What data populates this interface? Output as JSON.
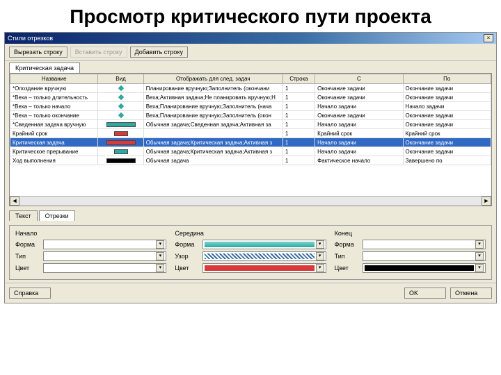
{
  "slide": {
    "title": "Просмотр критического пути проекта"
  },
  "dialog": {
    "title": "Стили отрезков",
    "close": "×",
    "toolbar": {
      "cut": "Вырезать строку",
      "paste": "Вставить строку",
      "add": "Добавить строку"
    },
    "top_tab": "Критическая задача",
    "columns": {
      "name": "Название",
      "vid": "Вид",
      "show": "Отображать для след. задач",
      "row": "Строка",
      "from": "С",
      "to": "По"
    },
    "rows": [
      {
        "name": "*Опоздание вручную",
        "vidType": "diamond",
        "show": "Планирование вручную;Заполнитель (окончани",
        "row": "1",
        "from": "Окончание задачи",
        "to": "Окончание задачи"
      },
      {
        "name": "*Веха – только длительность",
        "vidType": "diamond",
        "show": "Веха;Активная задача;Не планировать вручную;Н",
        "row": "1",
        "from": "Окончание задачи",
        "to": "Окончание задачи"
      },
      {
        "name": "*Веха – только начало",
        "vidType": "diamond",
        "show": "Веха;Планирование вручную;Заполнитель (нача",
        "row": "1",
        "from": "Начало задачи",
        "to": "Начало задачи"
      },
      {
        "name": "*Веха – только окончание",
        "vidType": "diamond",
        "show": "Веха;Планирование вручную;Заполнитель (окон",
        "row": "1",
        "from": "Окончание задачи",
        "to": "Окончание задачи"
      },
      {
        "name": "*Сведенная задача вручную",
        "vidType": "bar-teal",
        "show": "Обычная задача;Сведенная задача;Активная за",
        "row": "1",
        "from": "Начало задачи",
        "to": "Окончание задачи"
      },
      {
        "name": "Крайний срок",
        "vidType": "half-red",
        "show": "",
        "row": "1",
        "from": "Крайний срок",
        "to": "Крайний срок"
      },
      {
        "name": "Критическая задача",
        "vidType": "bar-red",
        "show": "Обычная задача;Критическая задача;Активная з",
        "row": "1",
        "from": "Начало задачи",
        "to": "Окончание задачи",
        "selected": true
      },
      {
        "name": "Критическое прерывание",
        "vidType": "half-teal",
        "show": "Обычная задача;Критическая задача;Активная з",
        "row": "1",
        "from": "Начало задачи",
        "to": "Окончание задачи"
      },
      {
        "name": "Ход выполнения",
        "vidType": "bar-black",
        "show": "Обычная задача",
        "row": "1",
        "from": "Фактическое начало",
        "to": "Завершено по"
      }
    ],
    "lower_tabs": {
      "text": "Текст",
      "bars": "Отрезки"
    },
    "sections": {
      "start": {
        "head": "Начало",
        "shape": "Форма",
        "type": "Тип",
        "color": "Цвет"
      },
      "middle": {
        "head": "Середина",
        "shape": "Форма",
        "pattern": "Узор",
        "color": "Цвет"
      },
      "end": {
        "head": "Конец",
        "shape": "Форма",
        "type": "Тип",
        "color": "Цвет"
      }
    },
    "footer": {
      "help": "Справка",
      "ok": "OK",
      "cancel": "Отмена"
    }
  }
}
